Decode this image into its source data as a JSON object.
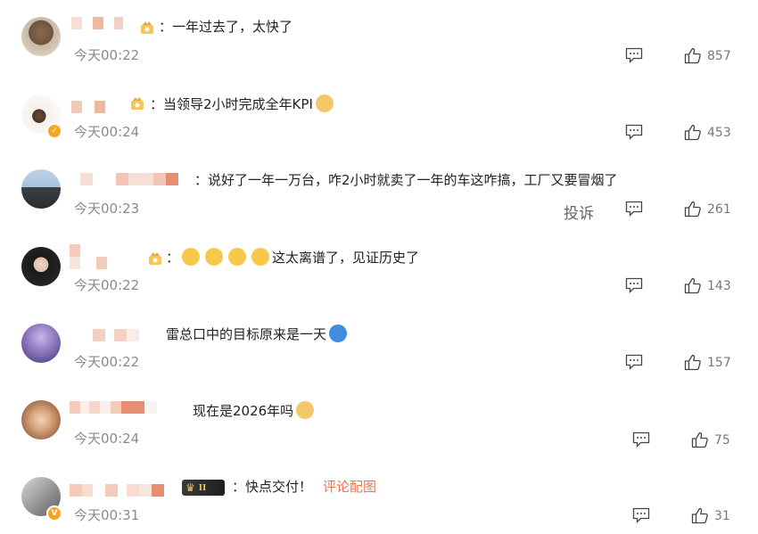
{
  "comments": [
    {
      "text": "一年过去了，太快了",
      "sep": "：",
      "time": "今天00:22",
      "likes": "857"
    },
    {
      "text": "当领导2小时完成全年KPI",
      "sep": "：",
      "time": "今天00:24",
      "likes": "453"
    },
    {
      "text": "说好了一年一万台，咋2小时就卖了一年的车这咋搞，工厂又要冒烟了",
      "sep": "：",
      "time": "今天00:23",
      "likes": "261",
      "report": "投诉"
    },
    {
      "text": "这太离谱了，见证历史了",
      "sep": "：",
      "time": "今天00:22",
      "likes": "143"
    },
    {
      "text": "雷总口中的目标原来是一天",
      "time": "今天00:22",
      "likes": "157"
    },
    {
      "text": "现在是2026年吗",
      "time": "今天00:24",
      "likes": "75"
    },
    {
      "text": "快点交付！",
      "sep": "：",
      "link": "评论配图",
      "badge": "II",
      "time": "今天00:31",
      "likes": "31"
    }
  ],
  "icons": {
    "comment": "comment-bubble-icon",
    "like": "thumbs-up-icon"
  },
  "colors": {
    "link": "#eb7350",
    "muted": "#8a8a8a",
    "vip": "#f5a623"
  }
}
